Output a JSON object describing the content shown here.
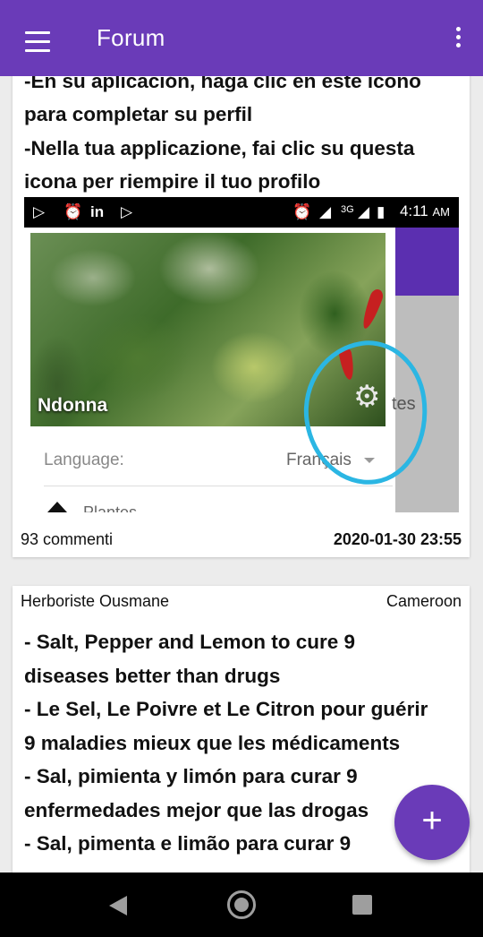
{
  "appbar": {
    "title": "Forum",
    "menu_icon": "menu-icon",
    "overflow_icon": "more-vert-icon",
    "color": "#6a3bb8"
  },
  "posts": [
    {
      "lines": [
        "-En su aplicación, haga clic en este icono",
        "para completar su perfil",
        "-Nella tua applicazione, fai clic su questa",
        "icona per riempire il tuo profilo"
      ],
      "screenshot": {
        "status_time": "4:11",
        "status_ampm": "AM",
        "network": "3G",
        "profile_name": "Ndonna",
        "partial_text": "tes",
        "language_label": "Language:",
        "language_value": "Français",
        "row_partial": "Plantes",
        "annotation_color": "#2bb6e3"
      },
      "comments": "93 commenti",
      "datetime": "2020-01-30 23:55"
    },
    {
      "author": "Herboriste Ousmane",
      "country": "Cameroon",
      "lines": [
        "- Salt, Pepper and Lemon to cure 9",
        "diseases better than drugs",
        "- Le Sel, Le Poivre et Le Citron pour guérir",
        "9 maladies mieux que les médicaments",
        "- Sal, pimienta y limón para curar 9",
        "enfermedades mejor que las drogas",
        "- Sal, pimenta e limão para curar 9"
      ]
    }
  ],
  "fab": {
    "label": "+",
    "icon": "add-icon"
  },
  "navbar": {
    "back_icon": "back-icon",
    "home_icon": "home-icon",
    "recents_icon": "recents-icon"
  }
}
